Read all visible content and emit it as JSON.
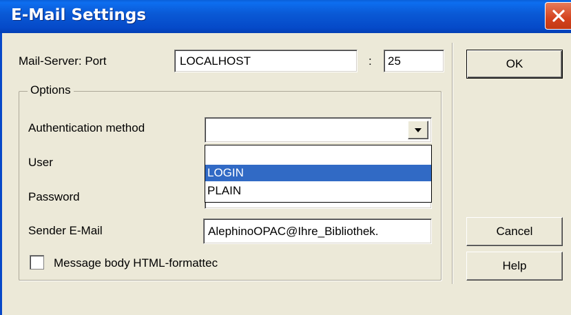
{
  "window": {
    "title": "E-Mail Settings",
    "close_icon": "close-icon"
  },
  "server": {
    "label": "Mail-Server: Port",
    "host": "LOCALHOST",
    "separator": ":",
    "port": "25"
  },
  "options": {
    "legend": "Options",
    "auth_label": "Authentication method",
    "auth_value": "",
    "auth_options": [
      "",
      "LOGIN",
      "PLAIN"
    ],
    "auth_highlighted": "LOGIN",
    "user_label": "User",
    "password_label": "Password",
    "sender_label": "Sender E-Mail",
    "sender_value": "AlephinoOPAC@Ihre_Bibliothek.",
    "html_checkbox_label": "Message body HTML-formattec",
    "html_checked": false
  },
  "buttons": {
    "ok": "OK",
    "cancel": "Cancel",
    "help": "Help"
  },
  "colors": {
    "titlebar": "#0a5ad6",
    "dialog_bg": "#ece9d8",
    "selection": "#316ac5",
    "close_button": "#d4421d"
  }
}
